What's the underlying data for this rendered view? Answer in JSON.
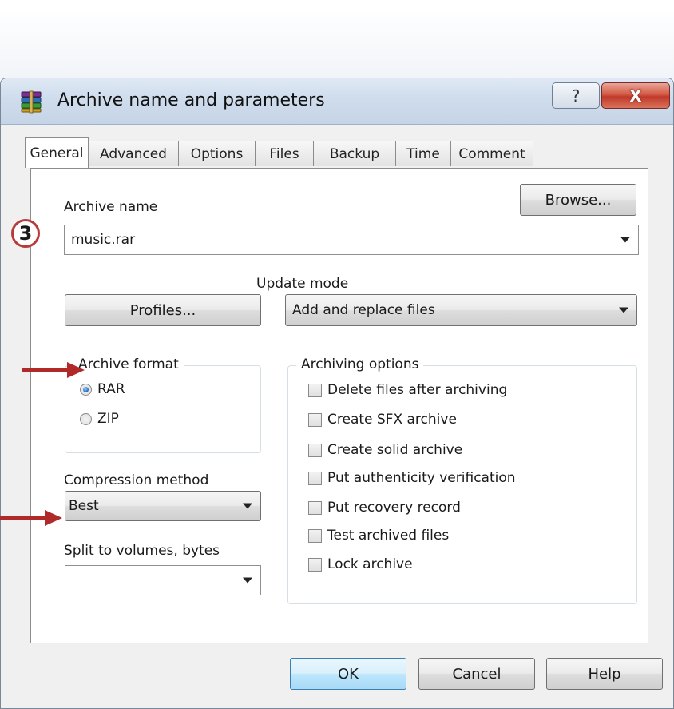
{
  "dialog": {
    "title": "Archive name and parameters",
    "help_label": "?",
    "close_label": "X"
  },
  "tabs": [
    {
      "label": "General",
      "active": true
    },
    {
      "label": "Advanced"
    },
    {
      "label": "Options"
    },
    {
      "label": "Files"
    },
    {
      "label": "Backup"
    },
    {
      "label": "Time"
    },
    {
      "label": "Comment"
    }
  ],
  "archive_name": {
    "label": "Archive name",
    "value": "music.rar",
    "browse_label": "Browse..."
  },
  "profiles_label": "Profiles...",
  "update_mode": {
    "label": "Update mode",
    "value": "Add and replace files"
  },
  "archive_format": {
    "title": "Archive format",
    "options": [
      {
        "label": "RAR",
        "checked": true
      },
      {
        "label": "ZIP",
        "checked": false
      }
    ]
  },
  "compression": {
    "label": "Compression method",
    "value": "Best"
  },
  "split": {
    "label": "Split to volumes, bytes",
    "value": ""
  },
  "archiving_options": {
    "title": "Archiving options",
    "items": [
      {
        "label": "Delete files after archiving",
        "checked": false
      },
      {
        "label": "Create SFX archive",
        "checked": false
      },
      {
        "label": "Create solid archive",
        "checked": false
      },
      {
        "label": "Put authenticity verification",
        "checked": false
      },
      {
        "label": "Put recovery record",
        "checked": false
      },
      {
        "label": "Test archived files",
        "checked": false
      },
      {
        "label": "Lock archive",
        "checked": false
      }
    ]
  },
  "footer": {
    "ok": "OK",
    "cancel": "Cancel",
    "help": "Help"
  },
  "annotation": {
    "step_number": "3"
  },
  "colors": {
    "annotation_red": "#b02a2a",
    "default_button_border": "#3c7fb1"
  }
}
